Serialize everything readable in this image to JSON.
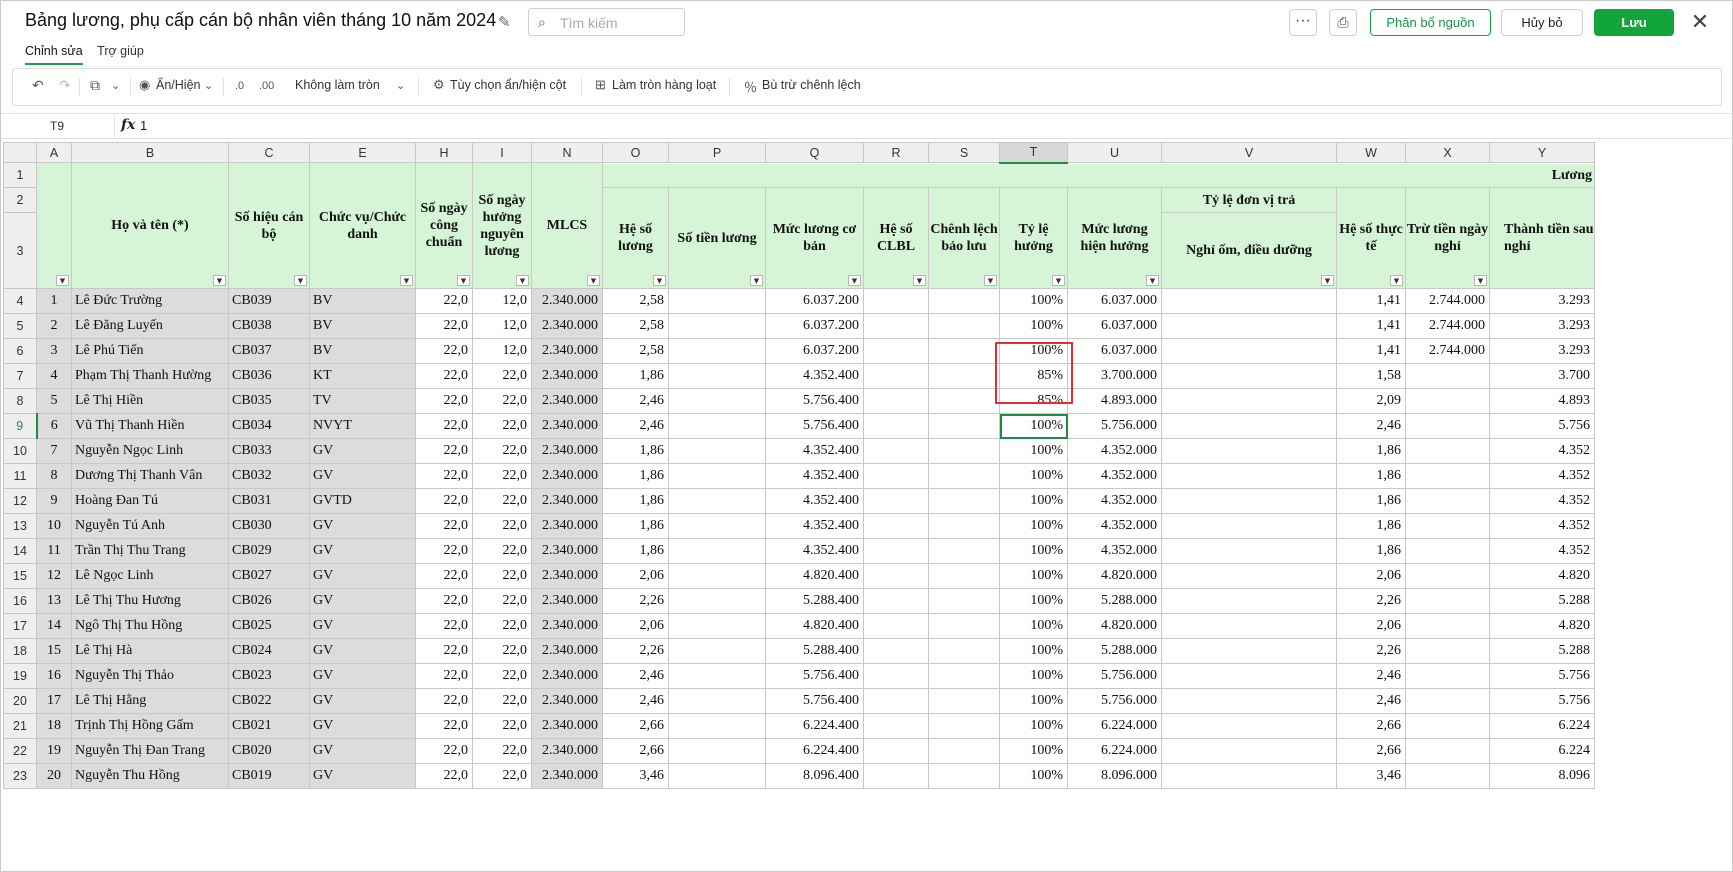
{
  "header": {
    "title": "Bảng lương, phụ cấp cán bộ nhân viên tháng 10 năm 2024",
    "search_placeholder": "Tìm kiếm",
    "more_label": "···",
    "alloc_label": "Phân bổ nguồn",
    "cancel_label": "Hủy bỏ",
    "save_label": "Lưu"
  },
  "menu_tabs": [
    "Chỉnh sửa",
    "Trợ giúp"
  ],
  "toolbar": {
    "show_hide": "Ẩn/Hiện",
    "rounding": "Không làm tròn",
    "column_options": "Tùy chọn ẩn/hiện cột",
    "bulk_round": "Làm tròn hàng loạt",
    "offset_diff": "Bù trừ chênh lệch"
  },
  "formula_bar": {
    "cell_ref": "T9",
    "fx": "fx",
    "value": "1"
  },
  "columns": [
    "A",
    "B",
    "C",
    "E",
    "H",
    "I",
    "N",
    "O",
    "P",
    "Q",
    "R",
    "S",
    "T",
    "U",
    "V",
    "W",
    "X",
    "Y"
  ],
  "row_numbers": [
    "1",
    "2",
    "3",
    "4",
    "5",
    "6",
    "7",
    "8",
    "9",
    "10",
    "11",
    "12",
    "13",
    "14",
    "15",
    "16",
    "17",
    "18",
    "19",
    "20",
    "21",
    "22",
    "23"
  ],
  "headers": {
    "ho_ten": "Họ và tên (*)",
    "so_hieu": "Số hiệu cán bộ",
    "chuc_vu": "Chức vụ/Chức danh",
    "ngay_cong": "Số ngày công chuẩn",
    "ngay_huong": "Số ngày hưởng nguyên lương",
    "mlcs": "MLCS",
    "luong_group": "Lương",
    "he_so_luong": "Hệ số lương",
    "so_tien_luong": "Số tiền lương",
    "muc_luong_co_ban": "Mức lương cơ bản",
    "he_so_clbl": "Hệ số CLBL",
    "chenh_lech": "Chênh lệch bảo lưu",
    "ty_le_huong": "Tỷ lệ hưởng",
    "muc_luong_hien_huong": "Mức lương hiện hưởng",
    "ty_le_don_vi_tra": "Tỷ lệ đơn vị trả",
    "nghi_om": "Nghỉ ốm, điều dưỡng",
    "he_so_thuc_te": "Hệ số thực tế",
    "tru_tien": "Trừ tiền ngày nghỉ",
    "thanh_tien": "Thành tiền sau nghỉ"
  },
  "rows": [
    {
      "stt": "1",
      "name": "Lê Đức Trường",
      "code": "CB039",
      "pos": "BV",
      "h": "22,0",
      "i": "12,0",
      "n": "2.340.000",
      "o": "2,58",
      "q": "6.037.200",
      "t": "100%",
      "u": "6.037.000",
      "w": "1,41",
      "x": "2.744.000",
      "y": "3.293"
    },
    {
      "stt": "2",
      "name": "Lê Đăng Luyến",
      "code": "CB038",
      "pos": "BV",
      "h": "22,0",
      "i": "12,0",
      "n": "2.340.000",
      "o": "2,58",
      "q": "6.037.200",
      "t": "100%",
      "u": "6.037.000",
      "w": "1,41",
      "x": "2.744.000",
      "y": "3.293"
    },
    {
      "stt": "3",
      "name": "Lê Phú Tiến",
      "code": "CB037",
      "pos": "BV",
      "h": "22,0",
      "i": "12,0",
      "n": "2.340.000",
      "o": "2,58",
      "q": "6.037.200",
      "t": "100%",
      "u": "6.037.000",
      "w": "1,41",
      "x": "2.744.000",
      "y": "3.293"
    },
    {
      "stt": "4",
      "name": "Phạm Thị Thanh  Hường",
      "code": "CB036",
      "pos": "KT",
      "h": "22,0",
      "i": "22,0",
      "n": "2.340.000",
      "o": "1,86",
      "q": "4.352.400",
      "t": "85%",
      "u": "3.700.000",
      "w": "1,58",
      "x": "",
      "y": "3.700"
    },
    {
      "stt": "5",
      "name": "Lê Thị Hiền",
      "code": "CB035",
      "pos": "TV",
      "h": "22,0",
      "i": "22,0",
      "n": "2.340.000",
      "o": "2,46",
      "q": "5.756.400",
      "t": "85%",
      "u": "4.893.000",
      "w": "2,09",
      "x": "",
      "y": "4.893"
    },
    {
      "stt": "6",
      "name": "Vũ Thị Thanh Hiền",
      "code": "CB034",
      "pos": "NVYT",
      "h": "22,0",
      "i": "22,0",
      "n": "2.340.000",
      "o": "2,46",
      "q": "5.756.400",
      "t": "100%",
      "u": "5.756.000",
      "w": "2,46",
      "x": "",
      "y": "5.756"
    },
    {
      "stt": "7",
      "name": "Nguyễn Ngọc Linh",
      "code": "CB033",
      "pos": "GV",
      "h": "22,0",
      "i": "22,0",
      "n": "2.340.000",
      "o": "1,86",
      "q": "4.352.400",
      "t": "100%",
      "u": "4.352.000",
      "w": "1,86",
      "x": "",
      "y": "4.352"
    },
    {
      "stt": "8",
      "name": "Dương Thị Thanh Vân",
      "code": "CB032",
      "pos": "GV",
      "h": "22,0",
      "i": "22,0",
      "n": "2.340.000",
      "o": "1,86",
      "q": "4.352.400",
      "t": "100%",
      "u": "4.352.000",
      "w": "1,86",
      "x": "",
      "y": "4.352"
    },
    {
      "stt": "9",
      "name": "Hoàng Đan Tú",
      "code": "CB031",
      "pos": "GVTD",
      "h": "22,0",
      "i": "22,0",
      "n": "2.340.000",
      "o": "1,86",
      "q": "4.352.400",
      "t": "100%",
      "u": "4.352.000",
      "w": "1,86",
      "x": "",
      "y": "4.352"
    },
    {
      "stt": "10",
      "name": "Nguyễn Tú Anh",
      "code": "CB030",
      "pos": "GV",
      "h": "22,0",
      "i": "22,0",
      "n": "2.340.000",
      "o": "1,86",
      "q": "4.352.400",
      "t": "100%",
      "u": "4.352.000",
      "w": "1,86",
      "x": "",
      "y": "4.352"
    },
    {
      "stt": "11",
      "name": "Trần Thị Thu Trang",
      "code": "CB029",
      "pos": "GV",
      "h": "22,0",
      "i": "22,0",
      "n": "2.340.000",
      "o": "1,86",
      "q": "4.352.400",
      "t": "100%",
      "u": "4.352.000",
      "w": "1,86",
      "x": "",
      "y": "4.352"
    },
    {
      "stt": "12",
      "name": "Lê Ngọc Linh",
      "code": "CB027",
      "pos": "GV",
      "h": "22,0",
      "i": "22,0",
      "n": "2.340.000",
      "o": "2,06",
      "q": "4.820.400",
      "t": "100%",
      "u": "4.820.000",
      "w": "2,06",
      "x": "",
      "y": "4.820"
    },
    {
      "stt": "13",
      "name": "Lê Thị Thu Hương",
      "code": "CB026",
      "pos": "GV",
      "h": "22,0",
      "i": "22,0",
      "n": "2.340.000",
      "o": "2,26",
      "q": "5.288.400",
      "t": "100%",
      "u": "5.288.000",
      "w": "2,26",
      "x": "",
      "y": "5.288"
    },
    {
      "stt": "14",
      "name": "Ngô Thị Thu Hồng",
      "code": "CB025",
      "pos": "GV",
      "h": "22,0",
      "i": "22,0",
      "n": "2.340.000",
      "o": "2,06",
      "q": "4.820.400",
      "t": "100%",
      "u": "4.820.000",
      "w": "2,06",
      "x": "",
      "y": "4.820"
    },
    {
      "stt": "15",
      "name": "Lê Thị Hà",
      "code": "CB024",
      "pos": "GV",
      "h": "22,0",
      "i": "22,0",
      "n": "2.340.000",
      "o": "2,26",
      "q": "5.288.400",
      "t": "100%",
      "u": "5.288.000",
      "w": "2,26",
      "x": "",
      "y": "5.288"
    },
    {
      "stt": "16",
      "name": "Nguyễn Thị Thảo",
      "code": "CB023",
      "pos": "GV",
      "h": "22,0",
      "i": "22,0",
      "n": "2.340.000",
      "o": "2,46",
      "q": "5.756.400",
      "t": "100%",
      "u": "5.756.000",
      "w": "2,46",
      "x": "",
      "y": "5.756"
    },
    {
      "stt": "17",
      "name": "Lê Thị Hằng",
      "code": "CB022",
      "pos": "GV",
      "h": "22,0",
      "i": "22,0",
      "n": "2.340.000",
      "o": "2,46",
      "q": "5.756.400",
      "t": "100%",
      "u": "5.756.000",
      "w": "2,46",
      "x": "",
      "y": "5.756"
    },
    {
      "stt": "18",
      "name": "Trịnh Thị Hồng Gấm",
      "code": "CB021",
      "pos": "GV",
      "h": "22,0",
      "i": "22,0",
      "n": "2.340.000",
      "o": "2,66",
      "q": "6.224.400",
      "t": "100%",
      "u": "6.224.000",
      "w": "2,66",
      "x": "",
      "y": "6.224"
    },
    {
      "stt": "19",
      "name": "Nguyễn Thị  Đan Trang",
      "code": "CB020",
      "pos": "GV",
      "h": "22,0",
      "i": "22,0",
      "n": "2.340.000",
      "o": "2,66",
      "q": "6.224.400",
      "t": "100%",
      "u": "6.224.000",
      "w": "2,66",
      "x": "",
      "y": "6.224"
    },
    {
      "stt": "20",
      "name": "Nguyễn Thu Hồng",
      "code": "CB019",
      "pos": "GV",
      "h": "22,0",
      "i": "22,0",
      "n": "2.340.000",
      "o": "3,46",
      "q": "8.096.400",
      "t": "100%",
      "u": "8.096.000",
      "w": "3,46",
      "x": "",
      "y": "8.096"
    }
  ],
  "colors": {
    "accent": "#12a53b",
    "header_fill": "#d6f5d6",
    "highlight": "#e03030"
  }
}
